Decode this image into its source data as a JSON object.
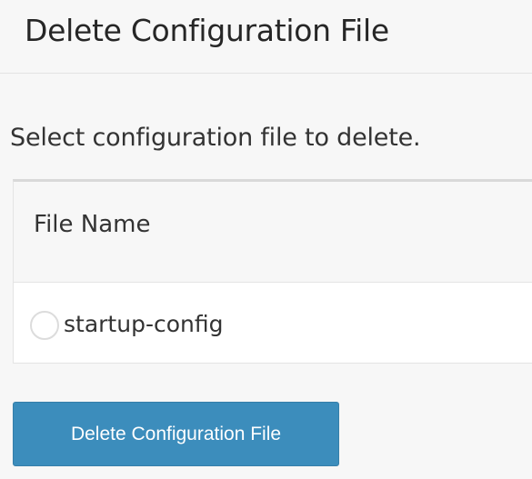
{
  "page": {
    "title": "Delete Configuration File",
    "instruction": "Select configuration file to delete."
  },
  "file_table": {
    "columns": [
      "File Name"
    ],
    "rows": [
      {
        "file_name": "startup-config",
        "selected": false
      }
    ]
  },
  "actions": {
    "delete_label": "Delete Configuration File"
  },
  "colors": {
    "accent": "#3c8dbc",
    "background": "#f7f7f7",
    "table_header_bg": "#f7f7f7",
    "row_bg": "#ffffff"
  },
  "icons": {
    "radio": "radio-icon"
  }
}
